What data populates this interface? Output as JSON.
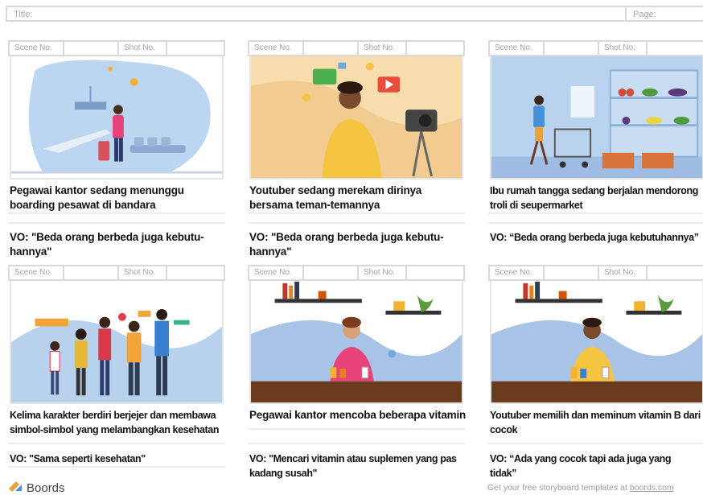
{
  "header": {
    "title_label": "Title:",
    "page_label": "Page:"
  },
  "panel_labels": {
    "scene": "Scene No.",
    "shot": "Shot No."
  },
  "panels": [
    {
      "desc": [
        "Pegawai kantor sedang menunggu",
        "boarding pesawat di bandara"
      ],
      "vo": [
        "VO: \"Beda orang berbeda juga kebutu-",
        "hannya\""
      ]
    },
    {
      "desc": [
        "Youtuber sedang merekam dirinya",
        "bersama teman-temannya"
      ],
      "vo": [
        "VO: \"Beda orang berbeda juga kebutu-",
        "hannya\""
      ]
    },
    {
      "desc": [
        "Ibu rumah tangga sedang berjalan mendorong",
        "troli di seupermarket"
      ],
      "vo": [
        "VO: “Beda orang berbeda juga kebutuhannya”"
      ]
    },
    {
      "desc": [
        "Kelima karakter berdiri berjejer dan membawa",
        "simbol-simbol yang melambangkan kesehatan"
      ],
      "vo": [
        "VO: \"Sama seperti kesehatan\""
      ]
    },
    {
      "desc": [
        "Pegawai kantor mencoba beberapa vitamin"
      ],
      "vo": [
        "VO: \"Mencari vitamin atau suplemen yang pas",
        "kadang susah\""
      ]
    },
    {
      "desc": [
        "Youtuber memilih dan meminum vitamin B dari",
        "cocok"
      ],
      "vo": [
        "VO: “Ada yang cocok tapi ada juga yang",
        "tidak”"
      ]
    }
  ],
  "footer": {
    "brand": "Boords",
    "promo_prefix": "Get your free storyboard templates at ",
    "promo_link": "boords.com"
  },
  "icons": [
    "boords-logo-icon"
  ],
  "colors": {
    "border": "#d9d9d9",
    "label_gray": "#a7a7a7",
    "sky": "#b7d4ef",
    "warm_bg": "#f6d9a8"
  }
}
